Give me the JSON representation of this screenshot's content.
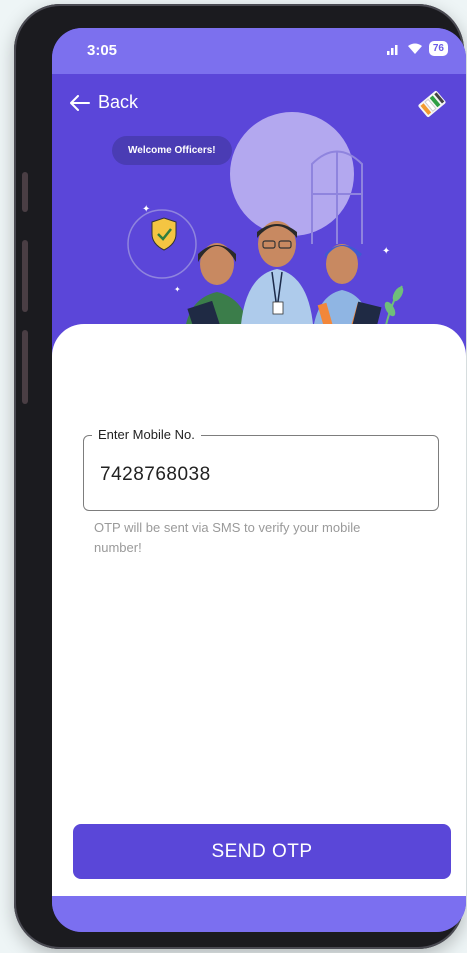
{
  "status_bar": {
    "time": "3:05",
    "battery": "76",
    "icons": [
      "signal-icon",
      "wifi-icon",
      "battery-icon"
    ]
  },
  "header": {
    "back_label": "Back",
    "back_icon": "arrow-left-icon",
    "logo_icon": "evm-icon",
    "welcome_text": "Welcome Officers!"
  },
  "form": {
    "mobile_label": "Enter Mobile No.",
    "mobile_value": "7428768038",
    "helper_text": "OTP will be sent via SMS to verify your mobile number!"
  },
  "actions": {
    "send_otp_label": "SEND OTP"
  },
  "colors": {
    "primary": "#5a47d8",
    "status_bar": "#7c70ee",
    "bottom_bar": "#7b6ff0"
  }
}
